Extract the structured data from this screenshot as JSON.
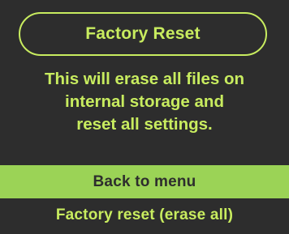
{
  "title": "Factory Reset",
  "message": {
    "lines": [
      "This will erase all files on",
      "internal storage and",
      "reset all settings."
    ]
  },
  "menu": {
    "items": [
      {
        "label": "Back to menu",
        "selected": true
      },
      {
        "label": "Factory reset (erase all)",
        "selected": false
      }
    ]
  },
  "colors": {
    "background": "#2d2d2d",
    "accent_text": "#c8ec5f",
    "selected_bg": "#9bd356",
    "selected_text": "#2d2d2d"
  }
}
